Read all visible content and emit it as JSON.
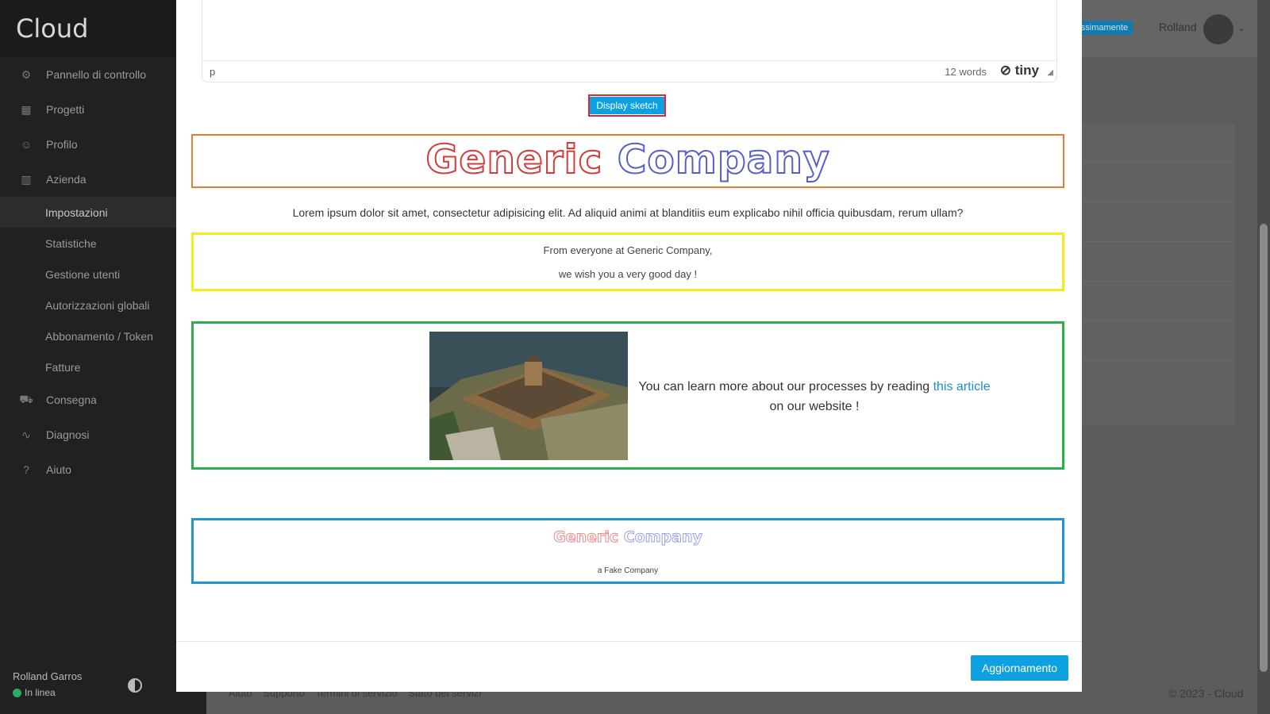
{
  "app": {
    "brand": "Cloud"
  },
  "sidebar": {
    "items": [
      {
        "label": "Pannello di controllo",
        "icon": "sliders-icon"
      },
      {
        "label": "Progetti",
        "icon": "layout-icon"
      },
      {
        "label": "Profilo",
        "icon": "user-icon"
      },
      {
        "label": "Azienda",
        "icon": "building-icon"
      }
    ],
    "subitems": [
      {
        "label": "Impostazioni",
        "active": true
      },
      {
        "label": "Statistiche"
      },
      {
        "label": "Gestione utenti"
      },
      {
        "label": "Autorizzazioni globali"
      },
      {
        "label": "Abbonamento / Token"
      },
      {
        "label": "Fatture"
      }
    ],
    "items_after": [
      {
        "label": "Consegna",
        "icon": "truck-icon"
      },
      {
        "label": "Diagnosi",
        "icon": "pulse-icon"
      },
      {
        "label": "Aiuto",
        "icon": "help-icon"
      }
    ],
    "user": {
      "name": "Rolland Garros",
      "status": "In linea"
    }
  },
  "header": {
    "badge": "rossimamente",
    "user": "Rolland"
  },
  "footer": {
    "links": [
      "Aiuto",
      "Supporto",
      "Termini di servizio",
      "Stato dei servizi"
    ],
    "copyright": "© 2023 - Cloud"
  },
  "editor": {
    "status_tag": "p",
    "word_count": "12 words",
    "brand": "tiny"
  },
  "modal": {
    "sketch_button": "Display sketch",
    "logo_word1": "Generic",
    "logo_word2": "Company",
    "lorem": "Lorem ipsum dolor sit amet, consectetur adipisicing elit. Ad aliquid animi at blanditiis eum explicabo nihil officia quibusdam, rerum ullam?",
    "greeting_line1": "From everyone at Generic Company,",
    "greeting_line2": "we wish you a very good day !",
    "learn_before": "You can learn more about our processes by reading ",
    "learn_link": "this article",
    "learn_after": " on our website !",
    "tagline": "a Fake Company",
    "update_button": "Aggiornamento"
  },
  "colors": {
    "accent": "#0ea1e1",
    "orange": "#f07a2b",
    "yellow": "#f5ea1a",
    "green": "#2bb04a",
    "blue": "#1f95d6",
    "online": "#27ae60"
  }
}
